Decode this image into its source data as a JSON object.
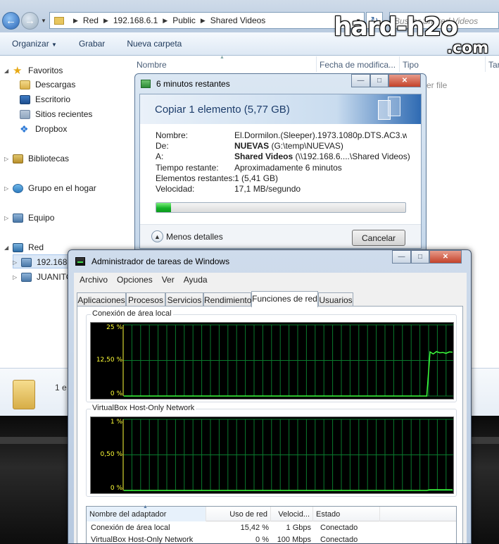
{
  "explorer": {
    "address": [
      "Red",
      "192.168.6.1",
      "Public",
      "Shared Videos"
    ],
    "search_placeholder": "Buscar Shared Videos",
    "toolbar": {
      "organize": "Organizar",
      "burn": "Grabar",
      "new_folder": "Nueva carpeta"
    },
    "columns": {
      "name": "Nombre",
      "date": "Fecha de modifica...",
      "type": "Tipo",
      "size": "Tar"
    },
    "ghost_row_type": "ver file",
    "nav": {
      "favorites": "Favoritos",
      "downloads": "Descargas",
      "desktop": "Escritorio",
      "recent": "Sitios recientes",
      "dropbox": "Dropbox",
      "libraries": "Bibliotecas",
      "homegroup": "Grupo en el hogar",
      "computer": "Equipo",
      "network": "Red",
      "host1": "192.168.6",
      "host2": "JUANITO"
    },
    "details_count": "1 e"
  },
  "watermark": {
    "line1": "hard-h2o",
    "line2": ".com"
  },
  "copy_dialog": {
    "title": "6 minutos restantes",
    "heading": "Copiar 1 elemento (5,77 GB)",
    "labels": {
      "name": "Nombre:",
      "from": "De:",
      "to": "A:",
      "time": "Tiempo restante:",
      "items": "Elementos restantes:",
      "speed": "Velocidad:"
    },
    "values": {
      "name": "El.Dormilon.(Sleeper).1973.1080p.DTS.AC3.w...",
      "from_bold": "NUEVAS",
      "from_rest": " (G:\\temp\\NUEVAS)",
      "to_bold": "Shared Videos",
      "to_rest": " (\\\\192.168.6....\\Shared Videos)",
      "time": "Aproximadamente 6 minutos",
      "items": "1 (5,41 GB)",
      "speed": "17,1 MB/segundo"
    },
    "progress_fraction": 0.06,
    "less_details": "Menos detalles",
    "cancel": "Cancelar"
  },
  "task_manager": {
    "title": "Administrador de tareas de Windows",
    "menu": [
      "Archivo",
      "Opciones",
      "Ver",
      "Ayuda"
    ],
    "tabs": [
      "Aplicaciones",
      "Procesos",
      "Servicios",
      "Rendimiento",
      "Funciones de red",
      "Usuarios"
    ],
    "active_tab": "Funciones de red",
    "graphs": [
      {
        "title": "Conexión de área local",
        "yticks": [
          "25 %",
          "12,50 %",
          "0 %"
        ]
      },
      {
        "title": "VirtualBox Host-Only Network",
        "yticks": [
          "1 %",
          "0,50 %",
          "0 %"
        ]
      }
    ],
    "table": {
      "headers": [
        "Nombre del adaptador",
        "Uso de red",
        "Velocid...",
        "Estado"
      ],
      "rows": [
        [
          "Conexión de área local",
          "15,42 %",
          "1 Gbps",
          "Conectado"
        ],
        [
          "VirtualBox Host-Only Network",
          "0 %",
          "100 Mbps",
          "Conectado"
        ]
      ]
    }
  },
  "colors": {
    "graph_line": "#3dff3d",
    "graph_grid": "#0a7a2d",
    "tick_text": "#ffff37",
    "progress": "#17b42a"
  },
  "chart_data": [
    {
      "type": "line",
      "title": "Conexión de área local",
      "ylabel": "",
      "ylim": [
        0,
        25
      ],
      "ytick_labels": [
        "25 %",
        "12,50 %",
        "0 %"
      ],
      "series": [
        {
          "values": [
            0,
            0,
            0,
            0,
            0,
            0,
            0,
            0,
            0,
            0,
            0,
            0,
            0,
            0,
            0,
            0,
            0,
            0,
            0,
            0,
            0,
            0,
            0,
            0,
            0,
            0,
            0,
            0,
            0,
            0,
            0,
            0,
            0,
            0,
            0,
            0,
            0,
            0,
            0,
            0,
            0,
            0,
            0,
            0,
            0,
            0,
            0,
            0,
            0,
            0,
            0,
            0,
            0,
            0,
            0,
            0,
            0,
            0,
            0,
            0,
            0,
            0,
            0,
            0,
            0,
            0,
            0,
            0,
            0,
            0,
            0,
            0,
            0,
            0,
            0,
            0,
            0,
            0,
            0,
            0,
            0,
            0,
            0,
            0,
            0,
            0,
            0,
            0,
            0,
            0,
            0,
            0,
            0,
            0,
            0,
            15.5,
            14.8,
            15.6,
            15.2,
            15.3,
            15.0,
            15.5,
            15.4
          ]
        }
      ]
    },
    {
      "type": "line",
      "title": "VirtualBox Host-Only Network",
      "ylabel": "",
      "ylim": [
        0,
        1
      ],
      "ytick_labels": [
        "1 %",
        "0,50 %",
        "0 %"
      ],
      "series": [
        {
          "values": [
            0,
            0,
            0,
            0,
            0,
            0,
            0,
            0,
            0,
            0,
            0,
            0,
            0,
            0,
            0,
            0,
            0,
            0,
            0,
            0,
            0,
            0,
            0,
            0,
            0,
            0,
            0,
            0,
            0,
            0,
            0,
            0,
            0,
            0,
            0,
            0,
            0,
            0,
            0,
            0,
            0,
            0,
            0,
            0,
            0,
            0,
            0,
            0,
            0,
            0,
            0,
            0,
            0,
            0,
            0,
            0,
            0,
            0,
            0,
            0,
            0,
            0,
            0,
            0,
            0,
            0,
            0,
            0,
            0,
            0,
            0,
            0,
            0,
            0,
            0,
            0,
            0,
            0,
            0,
            0,
            0,
            0,
            0,
            0,
            0,
            0,
            0,
            0,
            0,
            0,
            0,
            0,
            0,
            0,
            0,
            0.01,
            0.01,
            0.01,
            0.01,
            0.01,
            0.01,
            0.01,
            0.01
          ]
        }
      ]
    }
  ]
}
